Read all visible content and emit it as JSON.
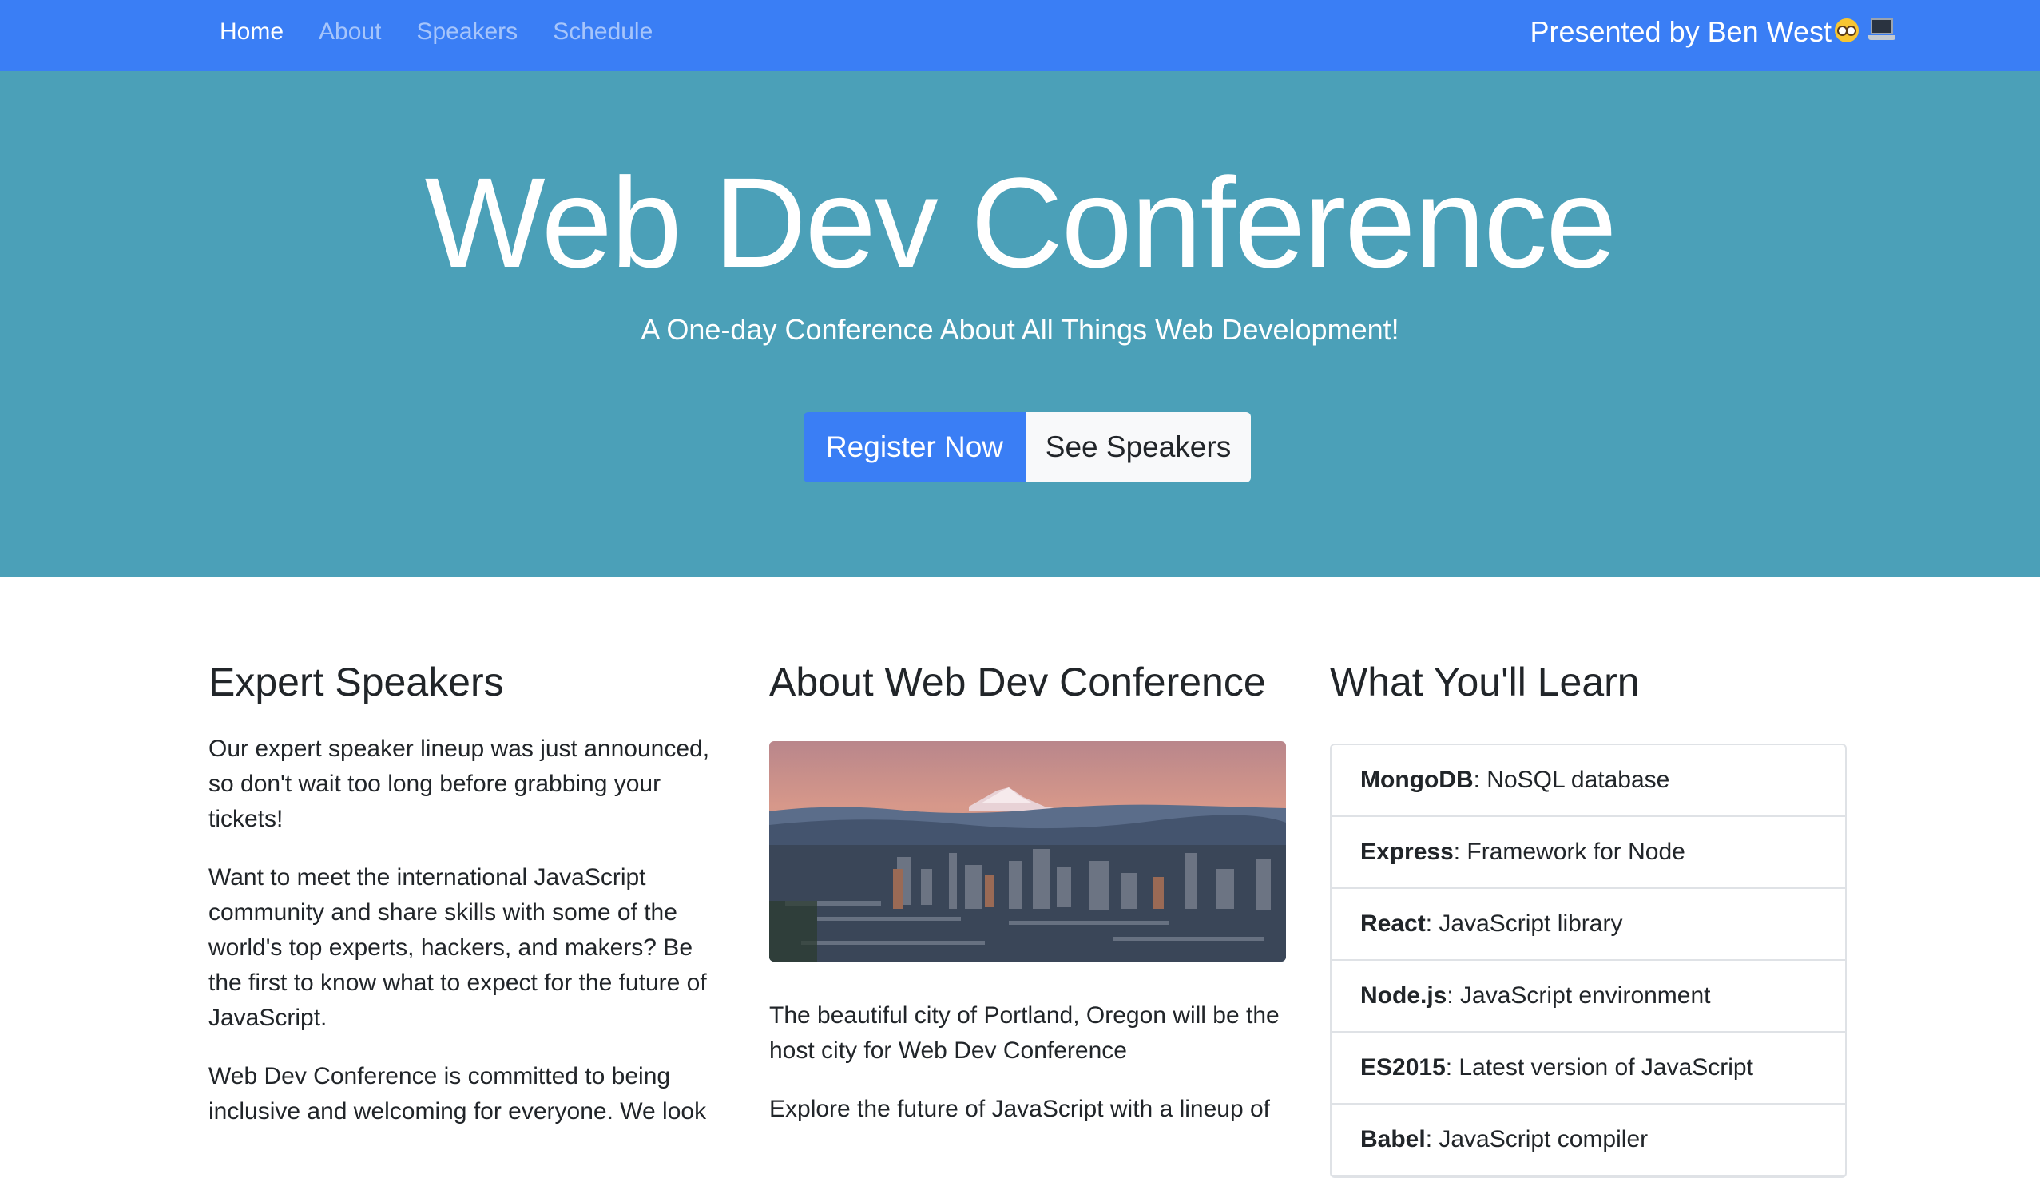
{
  "nav": {
    "links": [
      {
        "label": "Home",
        "active": true
      },
      {
        "label": "About",
        "active": false
      },
      {
        "label": "Speakers",
        "active": false
      },
      {
        "label": "Schedule",
        "active": false
      }
    ],
    "brand": "Presented by Ben West",
    "brand_icons": [
      "nerd-face-icon",
      "laptop-icon"
    ]
  },
  "hero": {
    "title": "Web Dev Conference",
    "subtitle": "A One-day Conference About All Things Web Development!",
    "register_label": "Register Now",
    "speakers_label": "See Speakers"
  },
  "speakers": {
    "heading": "Expert Speakers",
    "p1": "Our expert speaker lineup was just announced, so don't wait too long before grabbing your tickets!",
    "p2": "Want to meet the international JavaScript community and share skills with some of the world's top experts, hackers, and makers? Be the first to know what to expect for the future of JavaScript.",
    "p3": "Web Dev Conference is committed to being inclusive and welcoming for everyone. We look"
  },
  "about": {
    "heading": "About Web Dev Conference",
    "image_subject": "portland-skyline-mt-hood",
    "p1": "The beautiful city of Portland, Oregon will be the host city for Web Dev Conference",
    "p2": "Explore the future of JavaScript with a lineup of"
  },
  "learn": {
    "heading": "What You'll Learn",
    "items": [
      {
        "name": "MongoDB",
        "desc": ": NoSQL database"
      },
      {
        "name": "Express",
        "desc": ": Framework for Node"
      },
      {
        "name": "React",
        "desc": ": JavaScript library"
      },
      {
        "name": "Node.js",
        "desc": ": JavaScript environment"
      },
      {
        "name": "ES2015",
        "desc": ": Latest version of JavaScript"
      },
      {
        "name": "Babel",
        "desc": ": JavaScript compiler"
      }
    ]
  },
  "colors": {
    "navbar": "#3a7ef5",
    "hero": "#4ba0b8",
    "primary_button": "#3a7ef5",
    "light_button": "#f8f9fa"
  }
}
